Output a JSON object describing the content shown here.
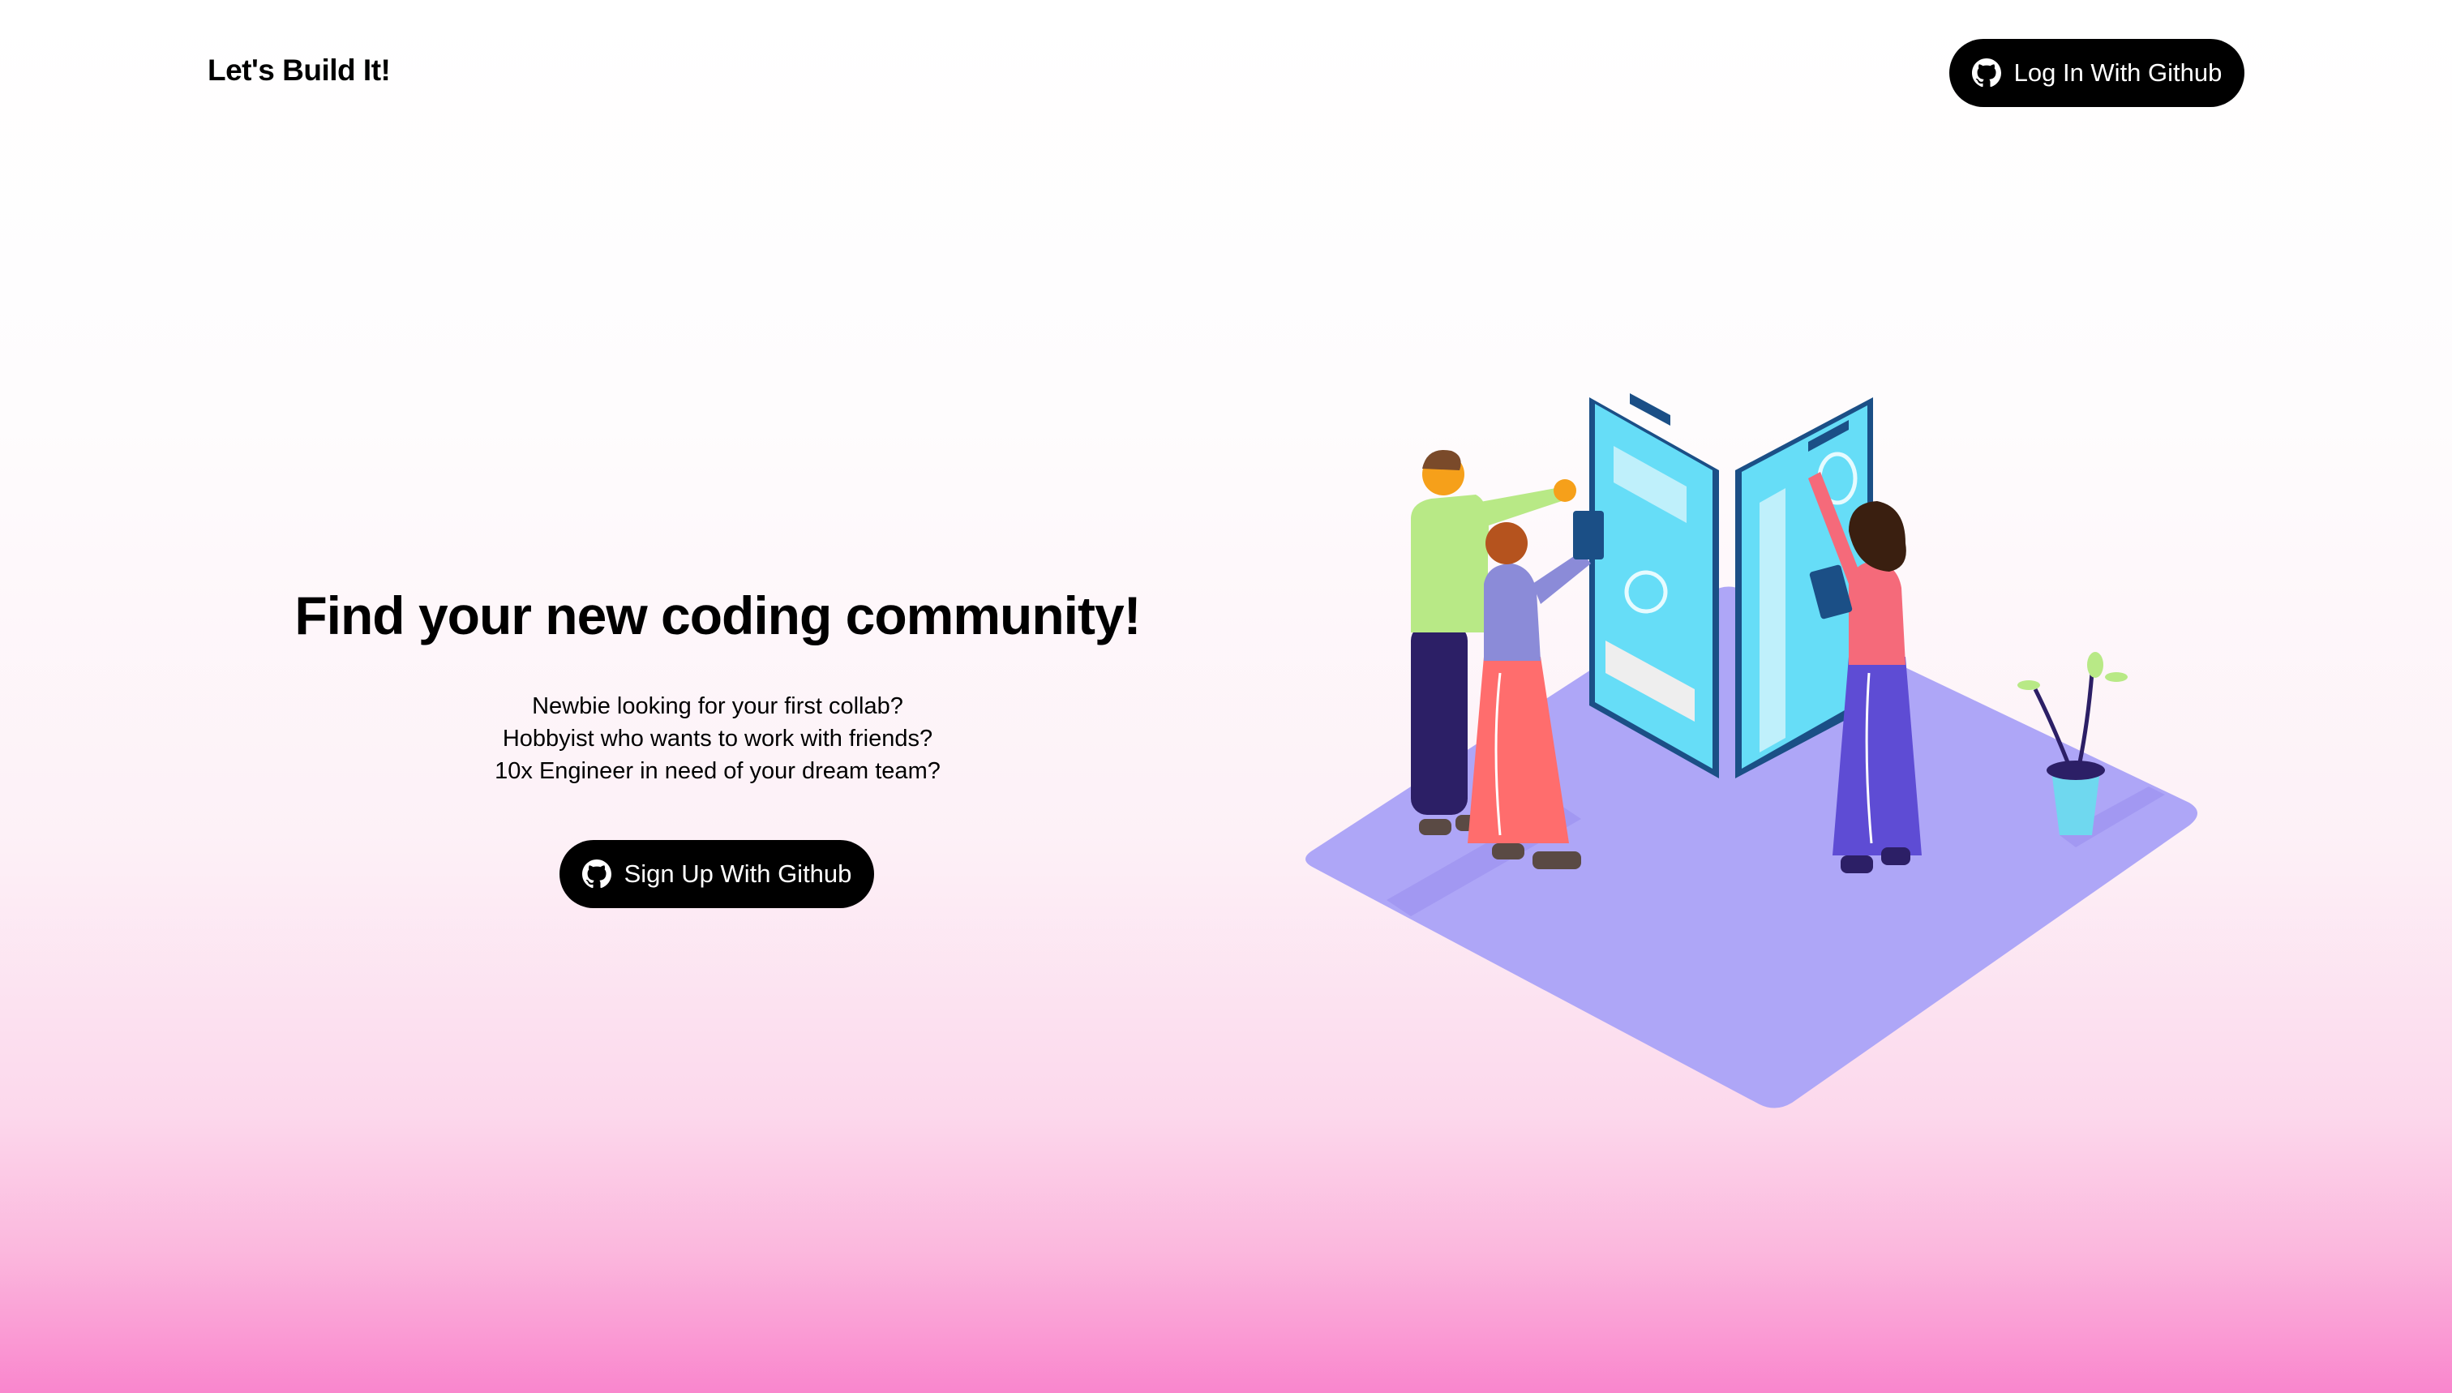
{
  "header": {
    "brand": "Let's Build It!",
    "login_label": "Log In With Github",
    "login_icon": "github-icon"
  },
  "hero": {
    "heading": "Find your new coding community!",
    "lines": [
      "Newbie looking for your first collab?",
      "Hobbyist who wants to work with friends?",
      "10x Engineer in need of your dream team?"
    ],
    "signup_label": "Sign Up With Github",
    "signup_icon": "github-icon"
  },
  "colors": {
    "button_bg": "#000000",
    "button_text": "#ffffff",
    "gradient_bottom": "#f986cd",
    "platform": "#aea6f7",
    "screen": "#66ddf7"
  }
}
